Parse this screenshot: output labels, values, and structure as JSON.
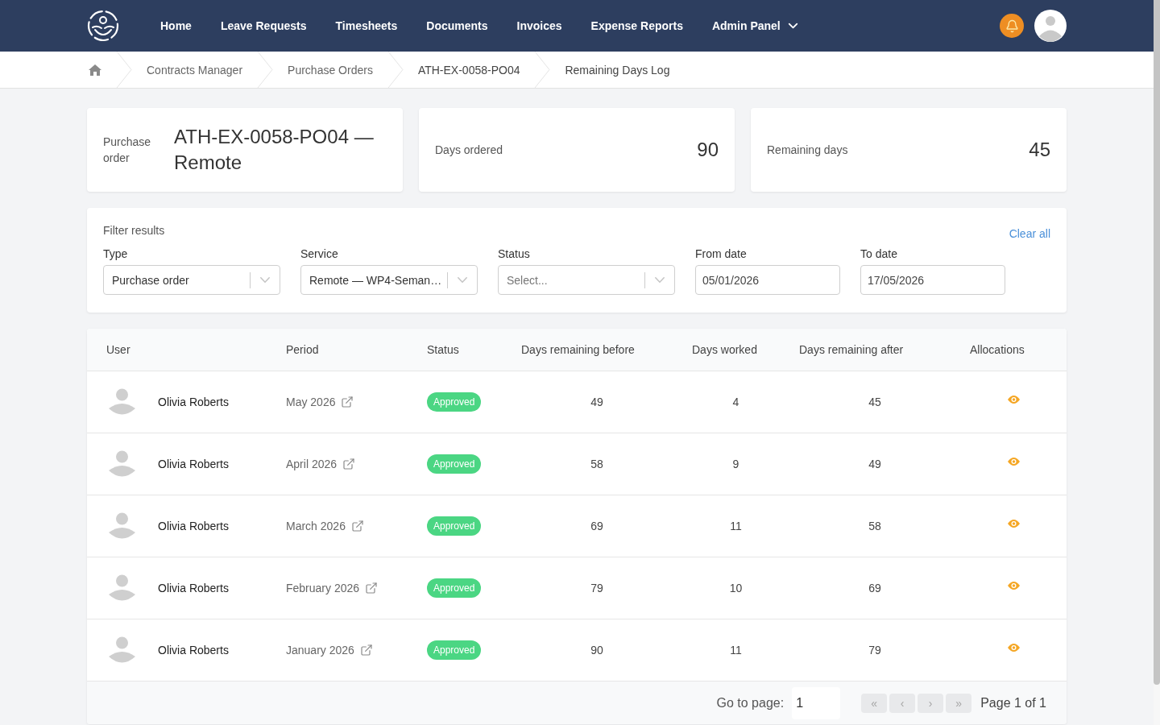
{
  "nav": {
    "links": [
      {
        "kind": "link",
        "label": "Home"
      },
      {
        "kind": "link",
        "label": "Leave Requests"
      },
      {
        "kind": "link",
        "label": "Timesheets"
      },
      {
        "kind": "link",
        "label": "Documents"
      },
      {
        "kind": "link",
        "label": "Invoices"
      },
      {
        "kind": "link",
        "label": "Expense Reports"
      },
      {
        "kind": "menu",
        "label": "Admin Panel"
      }
    ]
  },
  "breadcrumb": [
    {
      "label": "Contracts Manager"
    },
    {
      "label": "Purchase Orders"
    },
    {
      "label": "ATH-EX-0058-PO04"
    },
    {
      "label": "Remaining Days Log"
    }
  ],
  "summary": [
    {
      "kind": "title",
      "label": "Purchase order",
      "value": "ATH-EX-0058-PO04 — Remote"
    },
    {
      "kind": "number",
      "label": "Days ordered",
      "value": "90"
    },
    {
      "kind": "number",
      "label": "Remaining days",
      "value": "45"
    }
  ],
  "filters": {
    "title": "Filter results",
    "clear": "Clear all",
    "fields": [
      {
        "kind": "select",
        "label": "Type",
        "value": "Purchase order"
      },
      {
        "kind": "select",
        "label": "Service",
        "value": "Remote — WP4-Seman…"
      },
      {
        "kind": "select",
        "label": "Status",
        "placeholder": "Select..."
      },
      {
        "kind": "date",
        "label": "From date",
        "value": "05/01/2026"
      },
      {
        "kind": "date",
        "label": "To date",
        "value": "17/05/2026"
      }
    ]
  },
  "table": {
    "columns": [
      "User",
      "Period",
      "Status",
      "Days remaining before",
      "Days worked",
      "Days remaining after",
      "Allocations"
    ],
    "rows": [
      {
        "user": "Olivia Roberts",
        "period": "May 2026",
        "status": "Approved",
        "days_before": "49",
        "days_worked": "4",
        "days_after": "45"
      },
      {
        "user": "Olivia Roberts",
        "period": "April 2026",
        "status": "Approved",
        "days_before": "58",
        "days_worked": "9",
        "days_after": "49"
      },
      {
        "user": "Olivia Roberts",
        "period": "March 2026",
        "status": "Approved",
        "days_before": "69",
        "days_worked": "11",
        "days_after": "58"
      },
      {
        "user": "Olivia Roberts",
        "period": "February 2026",
        "status": "Approved",
        "days_before": "79",
        "days_worked": "10",
        "days_after": "69"
      },
      {
        "user": "Olivia Roberts",
        "period": "January 2026",
        "status": "Approved",
        "days_before": "90",
        "days_worked": "11",
        "days_after": "79"
      }
    ]
  },
  "pagination": {
    "goto_label": "Go to page:",
    "page": "1",
    "buttons": [
      {
        "symbol": "«",
        "disabled": true
      },
      {
        "symbol": "‹",
        "disabled": true
      },
      {
        "symbol": "›",
        "disabled": true
      },
      {
        "symbol": "»",
        "disabled": true
      }
    ],
    "info": "Page 1 of 1"
  }
}
